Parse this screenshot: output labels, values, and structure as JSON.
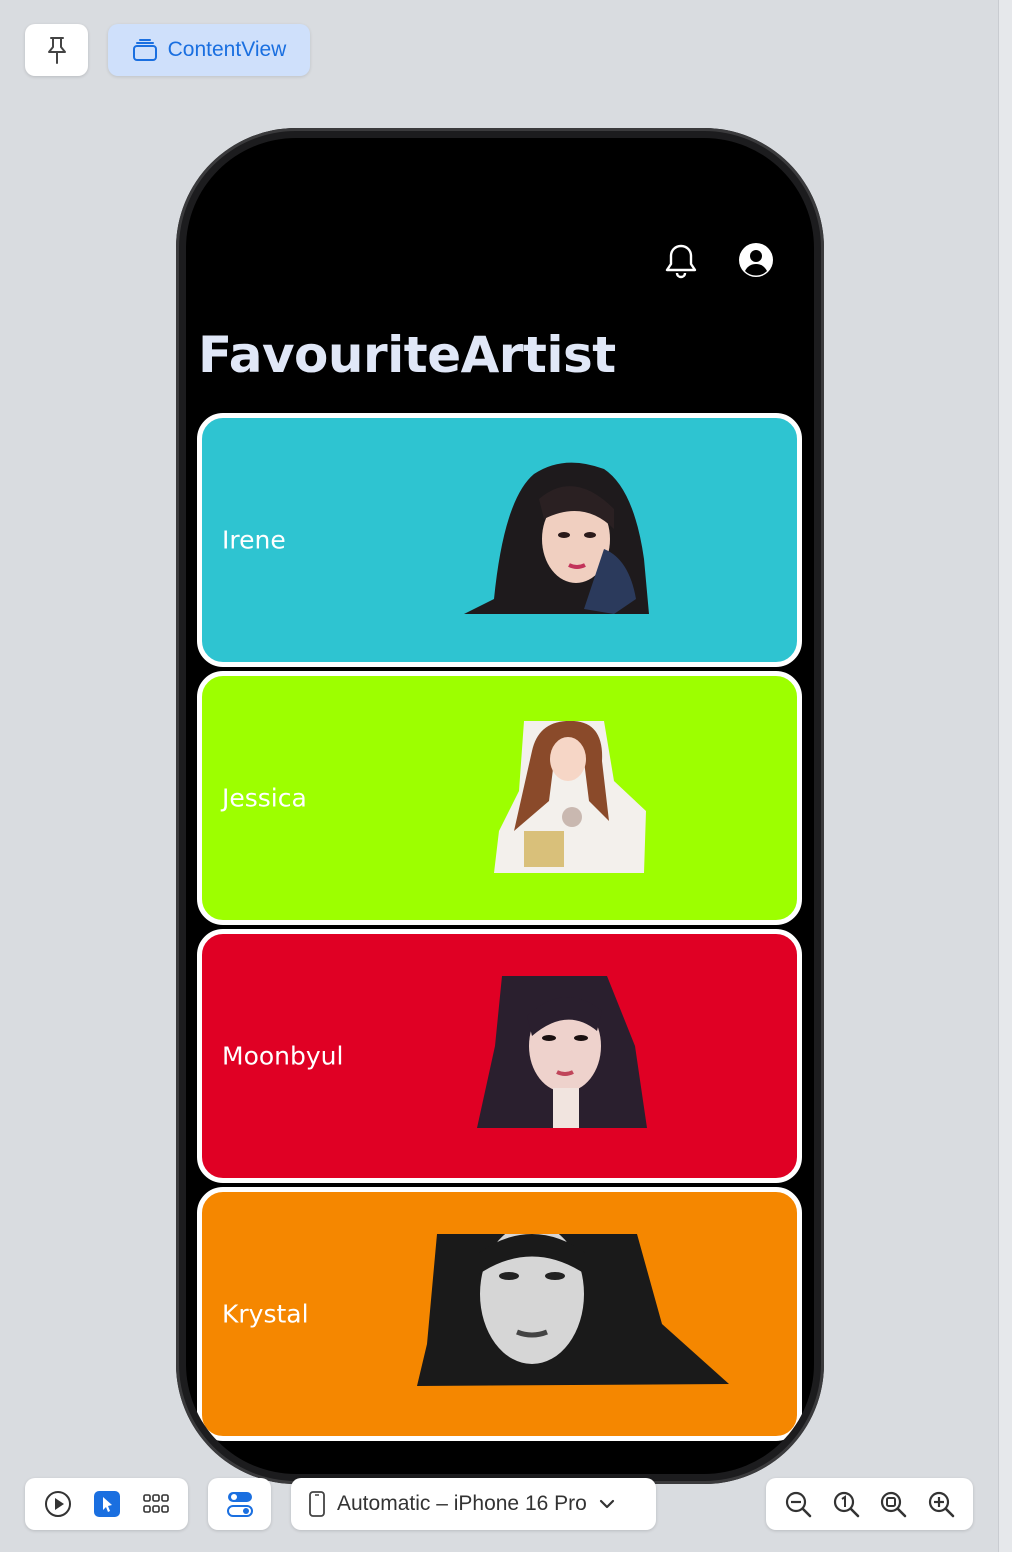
{
  "toolbar": {
    "pin_icon": "pin-icon",
    "content_view_label": "ContentView"
  },
  "app": {
    "title": "FavouriteArtist",
    "nav_icons": [
      "bell-icon",
      "person-circle-icon"
    ],
    "artists": [
      {
        "name": "Irene",
        "color": "#2ec4d1"
      },
      {
        "name": "Jessica",
        "color": "#9dff00"
      },
      {
        "name": "Moonbyul",
        "color": "#e00024"
      },
      {
        "name": "Krystal",
        "color": "#f58700"
      }
    ]
  },
  "bottom_bar": {
    "device_label": "Automatic – iPhone 16 Pro",
    "mode_icons": [
      "play-icon",
      "select-icon",
      "grid-icon"
    ],
    "zoom_icons": [
      "zoom-out-icon",
      "zoom-actual-icon",
      "zoom-fit-icon",
      "zoom-in-icon"
    ]
  }
}
